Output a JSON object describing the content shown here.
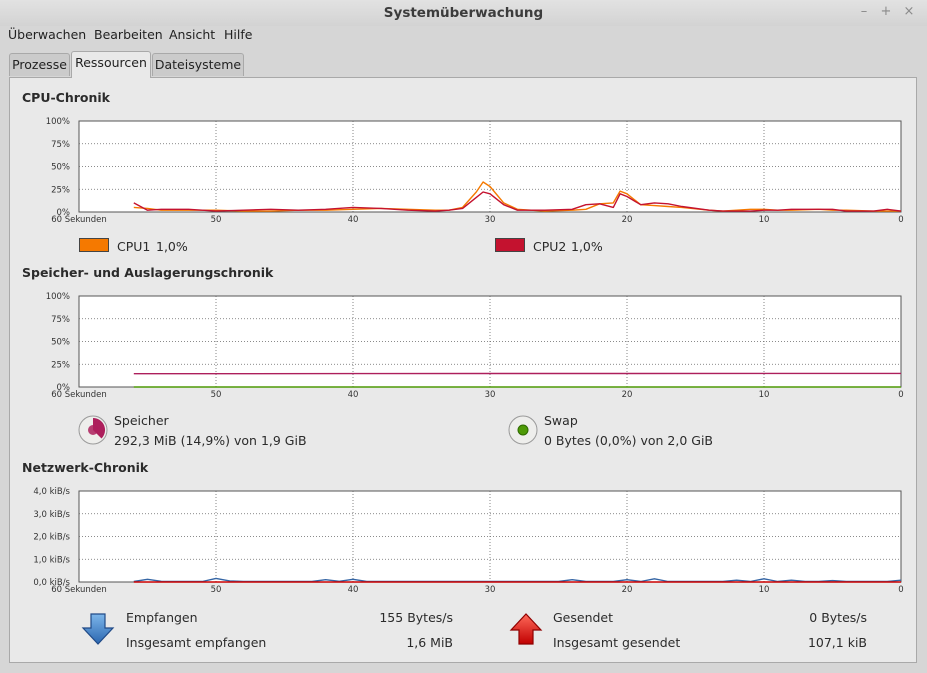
{
  "window": {
    "title": "Systemüberwachung"
  },
  "menu": {
    "items": [
      "Überwachen",
      "Bearbeiten",
      "Ansicht",
      "Hilfe"
    ]
  },
  "tabs": [
    {
      "label": "Prozesse",
      "active": false
    },
    {
      "label": "Ressourcen",
      "active": true
    },
    {
      "label": "Dateisysteme",
      "active": false
    }
  ],
  "cpu": {
    "title": "CPU-Chronik",
    "cpu1": {
      "name": "CPU1",
      "value": "1,0%",
      "color": "#f57900"
    },
    "cpu2": {
      "name": "CPU2",
      "value": "1,0%",
      "color": "#c4122f"
    }
  },
  "memory": {
    "title": "Speicher- und Auslagerungschronik",
    "ram": {
      "label": "Speicher",
      "value": "292,3 MiB (14,9%) von 1,9 GiB",
      "color": "#ad1f5c"
    },
    "swap": {
      "label": "Swap",
      "value": "0 Bytes (0,0%) von 2,0 GiB",
      "color": "#4e9a06"
    }
  },
  "network": {
    "title": "Netzwerk-Chronik",
    "received_label": "Empfangen",
    "received_value": "155 Bytes/s",
    "total_received_label": "Insgesamt empfangen",
    "total_received_value": "1,6 MiB",
    "sent_label": "Gesendet",
    "sent_value": "0 Bytes/s",
    "total_sent_label": "Insgesamt gesendet",
    "total_sent_value": "107,1 kiB",
    "received_icon": "arrow-down-icon",
    "sent_icon": "arrow-up-icon",
    "received_color": "#3465a4",
    "sent_color": "#cc0000"
  },
  "chart_data": [
    {
      "type": "line",
      "title": "CPU-Chronik",
      "x_ticks": [
        "60 Sekunden",
        "50",
        "40",
        "30",
        "20",
        "10",
        "0"
      ],
      "y_ticks": [
        "100%",
        "75%",
        "50%",
        "25%",
        "0%"
      ],
      "xlim": [
        60,
        0
      ],
      "ylim": [
        0,
        100
      ],
      "grid": true,
      "series": [
        {
          "name": "CPU1",
          "color": "#f57900",
          "x": [
            56,
            55,
            54,
            52,
            50,
            48,
            46,
            44,
            42,
            40,
            38,
            36,
            34,
            33,
            32,
            31,
            30.5,
            30,
            29,
            28,
            27,
            26,
            24,
            23,
            22,
            21,
            20.5,
            20,
            19,
            18,
            17,
            16,
            14,
            13,
            12,
            11,
            10,
            9,
            8,
            6,
            5,
            4,
            2,
            1,
            0
          ],
          "y": [
            5,
            4,
            2,
            2,
            2,
            1,
            1,
            2,
            2,
            3,
            4,
            3,
            2,
            2,
            5,
            22,
            33,
            28,
            10,
            3,
            2,
            1,
            2,
            3,
            9,
            10,
            23,
            20,
            8,
            7,
            6,
            5,
            2,
            1,
            2,
            3,
            3,
            2,
            2,
            3,
            2,
            2,
            1,
            1,
            1
          ]
        },
        {
          "name": "CPU2",
          "color": "#c4122f",
          "x": [
            56,
            55,
            54,
            52,
            50,
            48,
            46,
            44,
            42,
            40,
            38,
            36,
            34,
            33,
            32,
            31,
            30.5,
            30,
            29,
            28,
            27,
            26,
            24,
            23,
            22,
            21,
            20.5,
            20,
            19,
            18,
            17,
            16,
            14,
            13,
            12,
            11,
            10,
            9,
            8,
            6,
            5,
            4,
            2,
            1,
            0
          ],
          "y": [
            10,
            2,
            3,
            3,
            1,
            2,
            3,
            2,
            3,
            5,
            4,
            2,
            1,
            2,
            4,
            16,
            22,
            20,
            8,
            2,
            2,
            2,
            3,
            8,
            9,
            5,
            20,
            17,
            8,
            10,
            9,
            6,
            2,
            1,
            1,
            1,
            2,
            2,
            3,
            3,
            3,
            1,
            1,
            3,
            1
          ]
        }
      ]
    },
    {
      "type": "line",
      "title": "Speicher- und Auslagerungschronik",
      "x_ticks": [
        "60 Sekunden",
        "50",
        "40",
        "30",
        "20",
        "10",
        "0"
      ],
      "y_ticks": [
        "100%",
        "75%",
        "50%",
        "25%",
        "0%"
      ],
      "xlim": [
        60,
        0
      ],
      "ylim": [
        0,
        100
      ],
      "grid": true,
      "series": [
        {
          "name": "Speicher",
          "color": "#ad1f5c",
          "x": [
            56,
            40,
            30,
            20,
            10,
            0
          ],
          "y": [
            14.6,
            14.7,
            14.8,
            14.8,
            14.9,
            14.9
          ]
        },
        {
          "name": "Swap",
          "color": "#4e9a06",
          "x": [
            56,
            0
          ],
          "y": [
            0,
            0
          ]
        }
      ]
    },
    {
      "type": "line",
      "title": "Netzwerk-Chronik",
      "x_ticks": [
        "60 Sekunden",
        "50",
        "40",
        "30",
        "20",
        "10",
        "0"
      ],
      "y_ticks": [
        "4,0 kiB/s",
        "3,0 kiB/s",
        "2,0 kiB/s",
        "1,0 kiB/s",
        "0,0 kiB/s"
      ],
      "xlim": [
        60,
        0
      ],
      "ylim": [
        0,
        4
      ],
      "grid": true,
      "series": [
        {
          "name": "Empfangen",
          "color": "#3465a4",
          "x": [
            56,
            55,
            54,
            53,
            52,
            51,
            50,
            49,
            48,
            47,
            46,
            45,
            44,
            43,
            42,
            41,
            40,
            39,
            38,
            37,
            36,
            35,
            34,
            33,
            32,
            31,
            30,
            29,
            28,
            27,
            26,
            25,
            24,
            23,
            22,
            21,
            20,
            19,
            18,
            17,
            16,
            15,
            14,
            13,
            12,
            11,
            10,
            9,
            8,
            7,
            6,
            5,
            4,
            3,
            2,
            1,
            0
          ],
          "y": [
            0.02,
            0.12,
            0.03,
            0.02,
            0.02,
            0.02,
            0.16,
            0.05,
            0.02,
            0.02,
            0.02,
            0.02,
            0.02,
            0.02,
            0.1,
            0.03,
            0.12,
            0.02,
            0.02,
            0.02,
            0.02,
            0.02,
            0.02,
            0.02,
            0.02,
            0.02,
            0.02,
            0.02,
            0.02,
            0.02,
            0.02,
            0.02,
            0.1,
            0.02,
            0.02,
            0.02,
            0.1,
            0.02,
            0.14,
            0.02,
            0.02,
            0.02,
            0.02,
            0.02,
            0.08,
            0.02,
            0.14,
            0.02,
            0.08,
            0.02,
            0.02,
            0.06,
            0.02,
            0.02,
            0.02,
            0.02,
            0.08
          ]
        },
        {
          "name": "Gesendet",
          "color": "#cc0000",
          "x": [
            56,
            0
          ],
          "y": [
            0,
            0
          ]
        }
      ]
    }
  ]
}
